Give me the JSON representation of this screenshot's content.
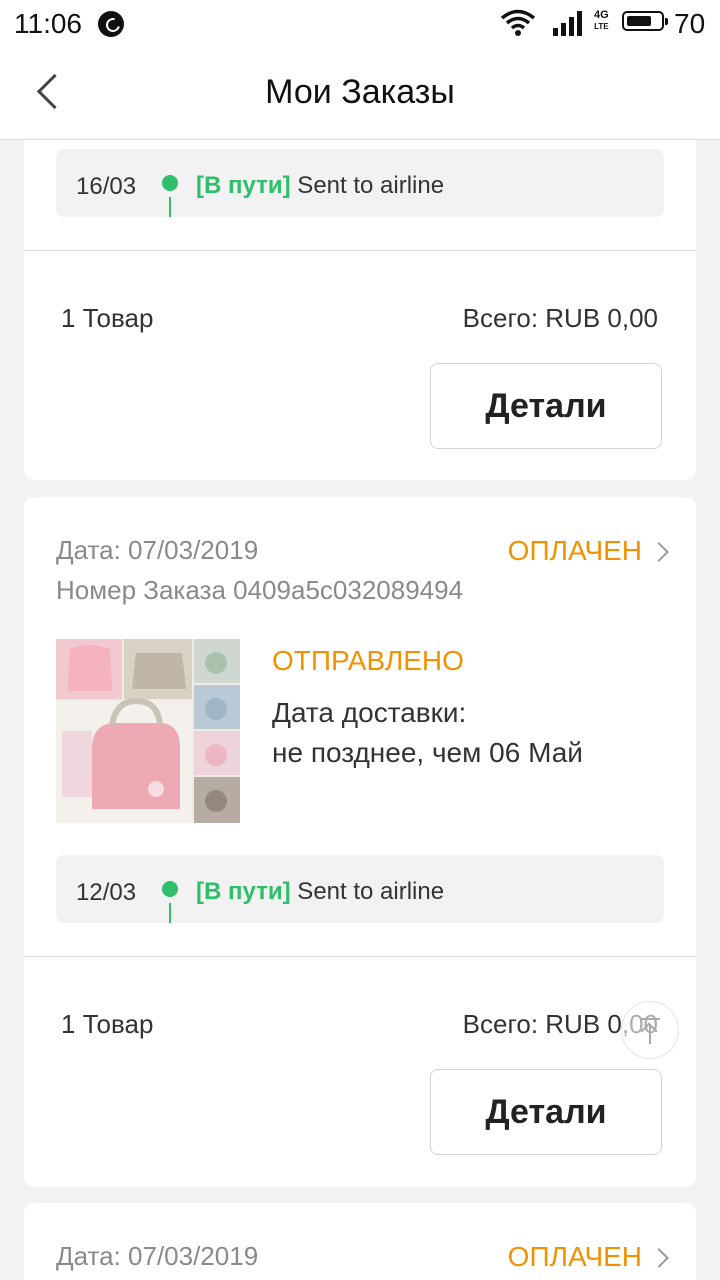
{
  "status_bar": {
    "time": "11:06",
    "network": "4G",
    "network_sub": "LTE",
    "battery": "70"
  },
  "header": {
    "title": "Мои Заказы"
  },
  "orders": [
    {
      "tracking": {
        "date": "16/03",
        "status": "[В пути]",
        "text": " Sent to airline"
      },
      "items": "1 Товар",
      "total": "Всего: RUB 0,00",
      "details_label": "Детали"
    },
    {
      "date": "Дата: 07/03/2019",
      "order_number": "Номер Заказа 0409a5c032089494",
      "status": "ОПЛАЧЕН",
      "shipping_status": "ОТПРАВЛЕНО",
      "delivery_label": "Дата доставки:",
      "delivery_date": "не позднее, чем 06 Май",
      "tracking": {
        "date": "12/03",
        "status": "[В пути]",
        "text": " Sent to airline"
      },
      "items": "1 Товар",
      "total": "Всего: RUB 0,00",
      "details_label": "Детали"
    },
    {
      "date": "Дата: 07/03/2019",
      "status": "ОПЛАЧЕН"
    }
  ],
  "colors": {
    "accent_orange": "#f39200",
    "tracking_green": "#2fbf6a"
  }
}
